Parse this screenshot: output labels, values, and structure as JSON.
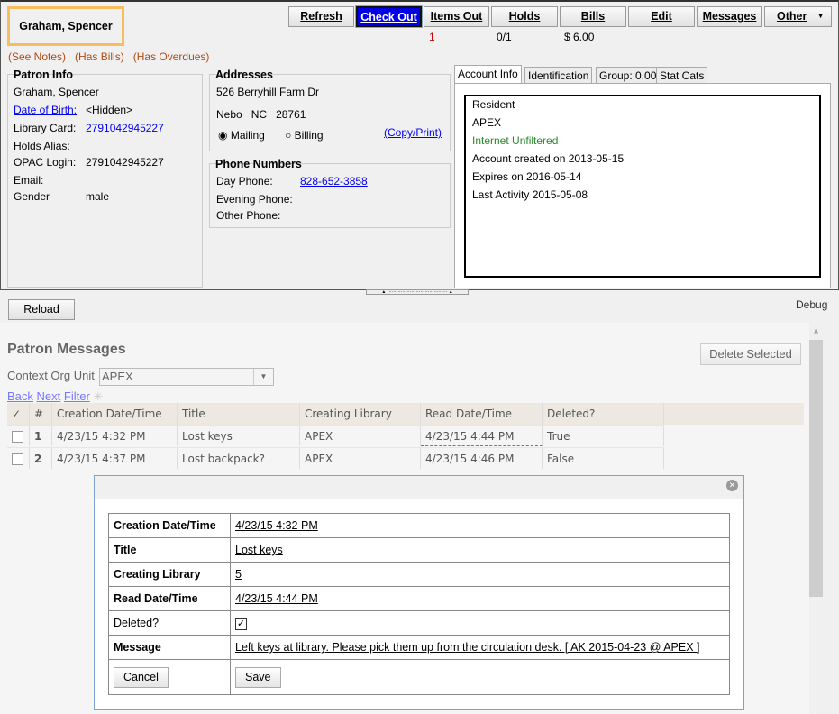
{
  "patron": {
    "name": "Graham, Spencer",
    "alerts": [
      "(See Notes)",
      "(Has Bills)",
      "(Has Overdues)"
    ]
  },
  "toolbar": {
    "buttons": [
      "Refresh",
      "Check Out",
      "Items Out",
      "Holds",
      "Bills",
      "Edit",
      "Messages",
      "Other"
    ],
    "items_out_count": "1",
    "holds_count": "0/1",
    "bills_amount": "$ 6.00"
  },
  "patron_info": {
    "title": "Patron Info",
    "name": "Graham, Spencer",
    "dob_label": "Date of Birth:",
    "dob_value": "<Hidden>",
    "card_label": "Library Card:",
    "card_value": "2791042945227",
    "alias_label": "Holds Alias:",
    "opac_label": "OPAC Login:",
    "opac_value": "2791042945227",
    "email_label": "Email:",
    "gender_label": "Gender",
    "gender_value": "male"
  },
  "addresses": {
    "title": "Addresses",
    "street": "526 Berryhill Farm Dr",
    "city": "Nebo",
    "state": "NC",
    "zip": "28761",
    "mailing": "Mailing",
    "billing": "Billing",
    "copy_print": "(Copy/Print)"
  },
  "phones": {
    "title": "Phone Numbers",
    "day_label": "Day Phone:",
    "day_value": "828-652-3858",
    "evening_label": "Evening Phone:",
    "other_label": "Other Phone:"
  },
  "tabs": [
    "Account Info",
    "Identification",
    "Group: 0.00",
    "Stat Cats"
  ],
  "account_info": {
    "residency": "Resident",
    "org": "APEX",
    "internet": "Internet Unfiltered",
    "created": "Account created on 2013-05-15",
    "expires": "Expires on 2016-05-14",
    "activity": "Last Activity 2015-05-08",
    "internet_color": "#2a8a2a"
  },
  "reload": "Reload",
  "debug": "Debug",
  "messages": {
    "title": "Patron Messages",
    "delete_selected": "Delete Selected",
    "context_label": "Context Org Unit",
    "context_value": "APEX",
    "back": "Back",
    "next": "Next",
    "filter": "Filter",
    "columns": [
      "✓",
      "#",
      "Creation Date/Time",
      "Title",
      "Creating Library",
      "Read Date/Time",
      "Deleted?"
    ],
    "rows": [
      [
        "1",
        "4/23/15 4:32 PM",
        "Lost keys",
        "APEX",
        "4/23/15 4:44 PM",
        "True"
      ],
      [
        "2",
        "4/23/15 4:37 PM",
        "Lost backpack?",
        "APEX",
        "4/23/15 4:46 PM",
        "False"
      ]
    ]
  },
  "dialog": {
    "fields": [
      {
        "k": "Creation Date/Time",
        "v": "4/23/15 4:32 PM"
      },
      {
        "k": "Title",
        "v": "Lost keys"
      },
      {
        "k": "Creating Library",
        "v": "5"
      },
      {
        "k": "Read Date/Time",
        "v": "4/23/15 4:44 PM"
      },
      {
        "k": "Deleted?",
        "v": "✓"
      },
      {
        "k": "Message",
        "v": "Left keys at library. Please pick them up from the circulation desk. [ AK 2015-04-23 @ APEX ]"
      }
    ],
    "cancel": "Cancel",
    "save": "Save"
  }
}
